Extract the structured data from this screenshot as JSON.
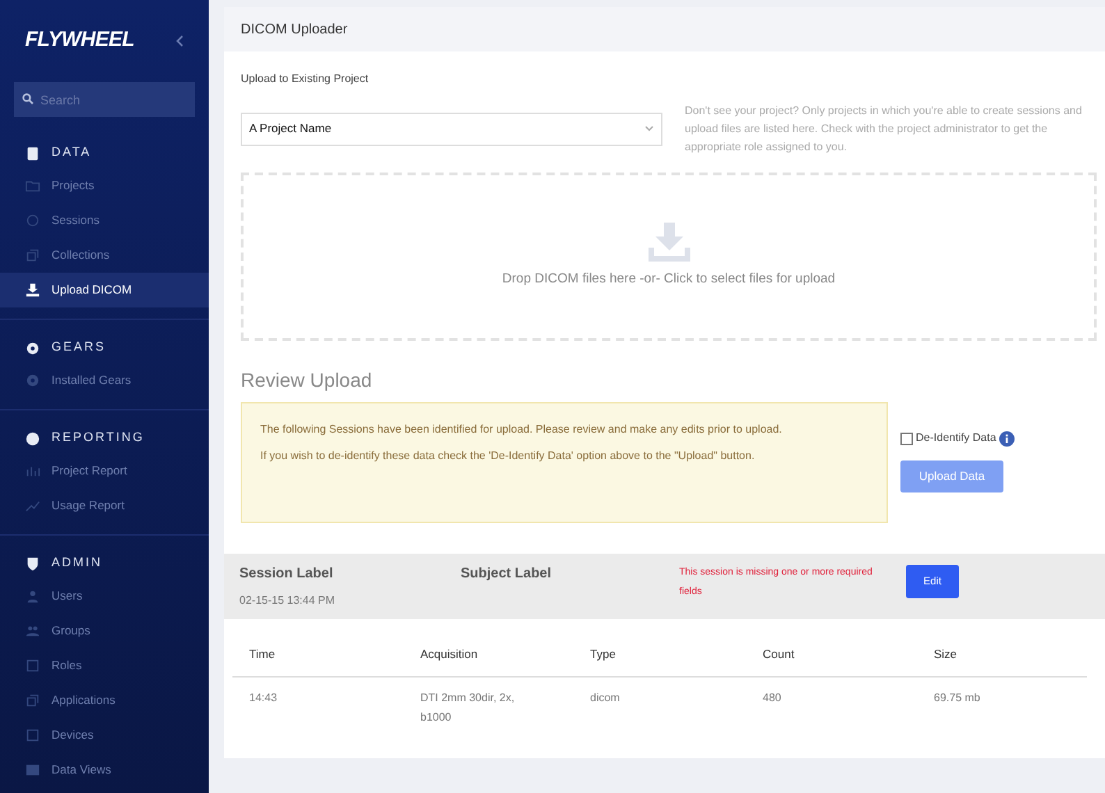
{
  "sidebar": {
    "logo": "FLYWHEEL",
    "search": {
      "placeholder": "Search"
    },
    "sections": [
      {
        "title": "DATA",
        "items": [
          {
            "label": "Projects",
            "selected": false
          },
          {
            "label": "Sessions",
            "selected": false
          },
          {
            "label": "Collections",
            "selected": false
          },
          {
            "label": "Upload DICOM",
            "selected": true
          }
        ]
      },
      {
        "title": "GEARS",
        "items": [
          {
            "label": "Installed Gears",
            "selected": false
          }
        ]
      },
      {
        "title": "REPORTING",
        "items": [
          {
            "label": "Project Report",
            "selected": false
          },
          {
            "label": "Usage Report",
            "selected": false
          }
        ]
      },
      {
        "title": "ADMIN",
        "items": [
          {
            "label": "Users",
            "selected": false
          },
          {
            "label": "Groups",
            "selected": false
          },
          {
            "label": "Roles",
            "selected": false
          },
          {
            "label": "Applications",
            "selected": false
          },
          {
            "label": "Devices",
            "selected": false
          },
          {
            "label": "Data Views",
            "selected": false
          }
        ]
      }
    ]
  },
  "page": {
    "title": "DICOM Uploader",
    "project": {
      "label": "Upload to Existing Project",
      "value": "A Project Name",
      "help": "Don't see your project? Only projects in which you're able to create sessions and upload files are listed here. Check with the project administrator to get the appropriate role assigned to you."
    },
    "dropzone": "Drop DICOM files here -or- Click to select files for upload",
    "review": {
      "title": "Review Upload",
      "notice": [
        "The following Sessions have been identified for upload. Please review and make any edits prior to upload.",
        "If you wish to de-identify these data check the 'De-Identify Data' option above to the \"Upload\" button."
      ],
      "deidentify": {
        "label": "De-Identify Data",
        "checked": false
      },
      "upload_button": {
        "label": "Upload Data",
        "disabled": true
      }
    },
    "session": {
      "session_label": "Session Label",
      "subject_label": "Subject Label",
      "date": "02-15-15 13:44 PM",
      "error": "This session is missing one or more required fields",
      "edit_button": "Edit"
    },
    "table": {
      "columns": [
        "Time",
        "Acquisition",
        "Type",
        "Count",
        "Size"
      ],
      "rows": [
        [
          "14:43",
          "DTI 2mm 30dir, 2x, b1000",
          "dicom",
          "480",
          "69.75 mb"
        ]
      ]
    }
  }
}
